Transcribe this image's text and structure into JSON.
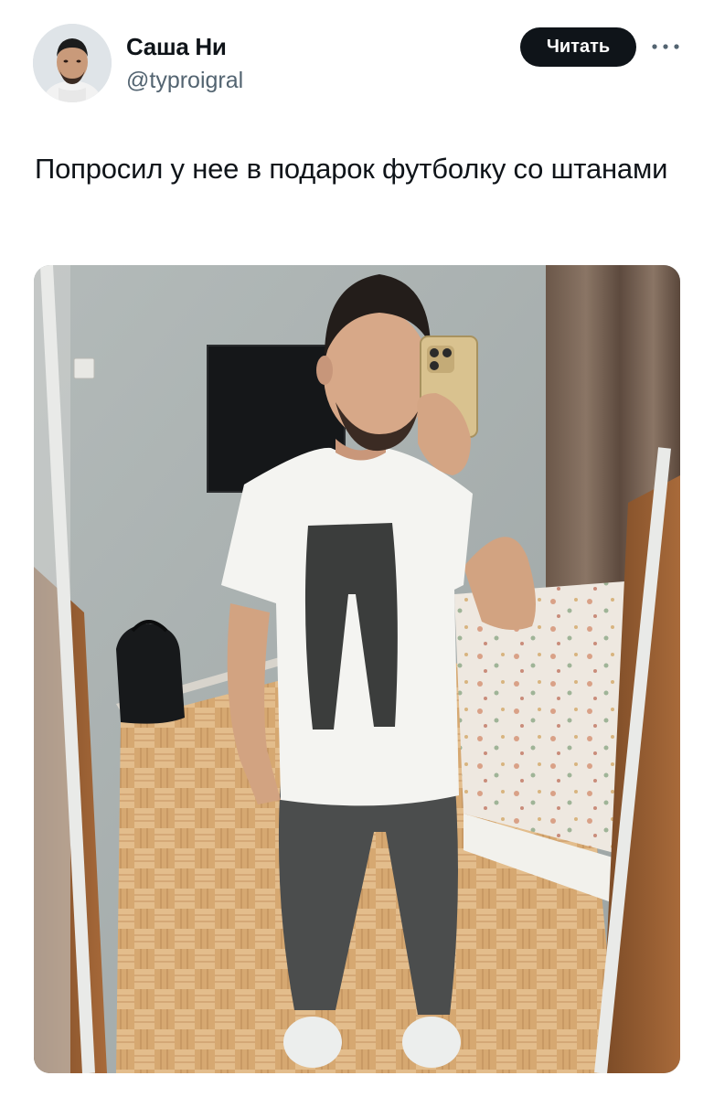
{
  "author": {
    "name": "Саша Ни",
    "handle": "@typroigral",
    "avatar_icon": "user-avatar-photo"
  },
  "actions": {
    "follow_label": "Читать",
    "more_icon": "more-dots-icon"
  },
  "tweet": {
    "text": "Попросил у нее в подарок футболку со штанами"
  },
  "media": {
    "description_icon": "mirror-selfie-photo"
  },
  "colors": {
    "text_primary": "#0f1419",
    "text_secondary": "#536471",
    "button_bg": "#0f1419",
    "button_text": "#ffffff"
  }
}
